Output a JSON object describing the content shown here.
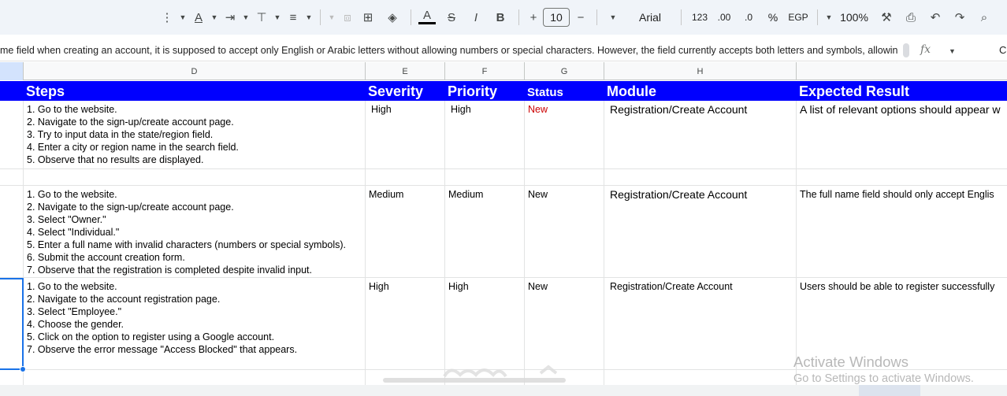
{
  "toolbar": {
    "font_size": "10",
    "font_name": "Arial",
    "number_format_123": "123",
    "decimal_increase": ".00",
    "decimal_decrease": ".0",
    "percent": "%",
    "currency": "EGP",
    "zoom": "100%",
    "bold": "B",
    "italic": "I",
    "plus": "+",
    "minus": "−"
  },
  "formula_bar": {
    "text": "me field when creating an account, it is supposed to accept only English or Arabic letters without allowing numbers or special characters. However, the field currently accepts both letters and symbols, allowing",
    "fx": "fx",
    "cell_ref_partial": "C"
  },
  "columns": [
    "D",
    "E",
    "F",
    "G",
    "H"
  ],
  "header": {
    "steps": "Steps",
    "severity": "Severity",
    "priority": "Priority",
    "status": "Status",
    "module": "Module",
    "expected": "Expected Result"
  },
  "rows": [
    {
      "steps": [
        "1. Go to the website.",
        "2. Navigate to the sign-up/create account page.",
        "3. Try to input data in the state/region field.",
        "4. Enter a city or region name in the search field.",
        "5. Observe that no results are displayed."
      ],
      "severity": "High",
      "priority": "High",
      "status": "New",
      "module": "Registration/Create Account",
      "expected": "A list of relevant options should appear w"
    },
    {
      "steps": [
        "1. Go to the website.",
        "2. Navigate to the sign-up/create account page.",
        "3. Select \"Owner.\"",
        "4. Select \"Individual.\"",
        "5. Enter a full name with invalid characters (numbers or special symbols).",
        "6. Submit the account creation form.",
        "7. Observe that the registration is completed despite invalid input."
      ],
      "severity": "Medium",
      "priority": "Medium",
      "status": "New",
      "module": "Registration/Create Account",
      "expected": "The full name field should only accept Englis"
    },
    {
      "steps": [
        "1. Go to the website.",
        "2. Navigate to the account registration page.",
        "3. Select \"Employee.\"",
        "4. Choose the gender.",
        "5. Click on the option to register using a Google account.",
        "7. Observe the error message \"Access Blocked\" that appears."
      ],
      "severity": "High",
      "priority": "High",
      "status": "New",
      "module": "Registration/Create Account",
      "expected": "Users should be able to register successfully"
    }
  ],
  "watermark": {
    "title": "Activate Windows",
    "subtitle": "Go to Settings to activate Windows."
  },
  "colors": {
    "header_blue": "#0000ff",
    "status_new_red": "#cc0000",
    "selection_blue": "#1a73e8"
  }
}
